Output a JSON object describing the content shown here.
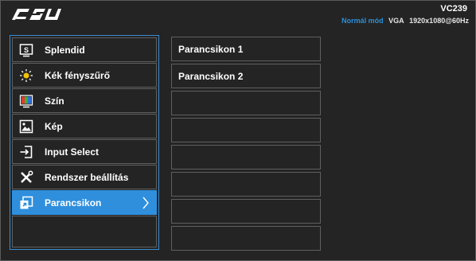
{
  "header": {
    "logo_icon": "asus-logo",
    "model": "VC239",
    "mode": "Normál mód",
    "source": "VGA",
    "resolution": "1920x1080@60Hz"
  },
  "menu": {
    "items": [
      {
        "label": "Splendid",
        "icon": "splendid-icon"
      },
      {
        "label": "Kék fényszűrő",
        "icon": "blue-light-icon"
      },
      {
        "label": "Szín",
        "icon": "color-icon"
      },
      {
        "label": "Kép",
        "icon": "image-icon"
      },
      {
        "label": "Input Select",
        "icon": "input-select-icon"
      },
      {
        "label": "Rendszer beállítás",
        "icon": "system-setup-icon"
      },
      {
        "label": "Parancsikon",
        "icon": "shortcut-icon",
        "selected": true
      }
    ]
  },
  "submenu": {
    "items": [
      {
        "label": "Parancsikon 1"
      },
      {
        "label": "Parancsikon 2"
      },
      {
        "label": ""
      },
      {
        "label": ""
      },
      {
        "label": ""
      },
      {
        "label": ""
      },
      {
        "label": ""
      },
      {
        "label": ""
      }
    ]
  },
  "colors": {
    "background": "#242424",
    "accent": "#2f8fdd",
    "mode_text": "#2b8fd6",
    "border": "#5f5f5f"
  }
}
